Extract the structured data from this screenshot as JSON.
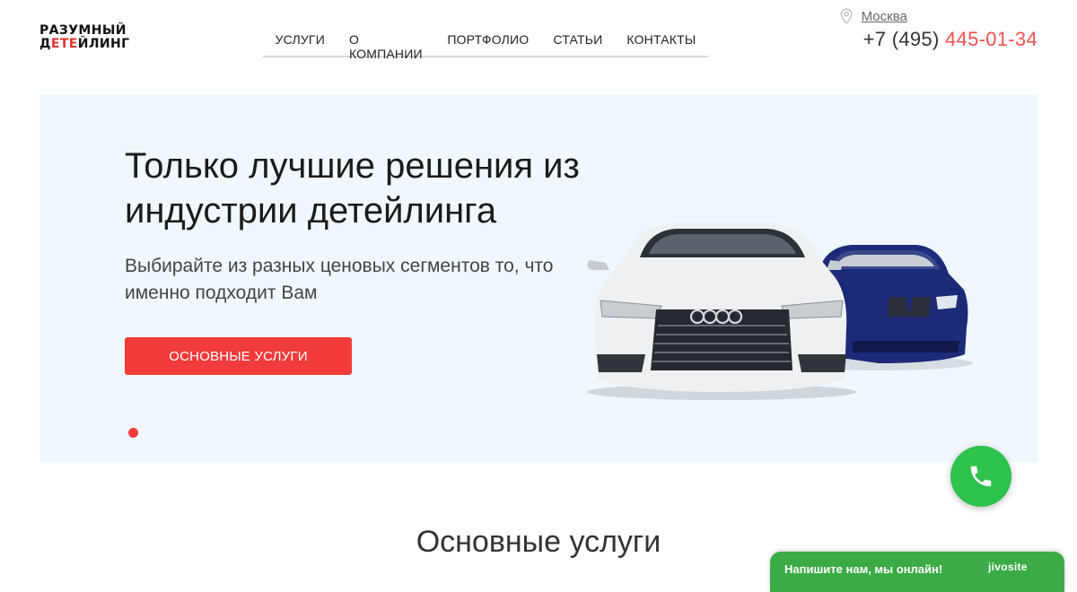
{
  "logo": {
    "line1": "РАЗУМНЫЙ",
    "line2_a": "Д",
    "line2_b": "ЕТЕ",
    "line2_c": "ЙЛИНГ"
  },
  "nav": {
    "items": [
      "УСЛУГИ",
      "О КОМПАНИИ",
      "ПОРТФОЛИО",
      "СТАТЬИ",
      "КОНТАКТЫ"
    ]
  },
  "contact": {
    "city": "Москва",
    "phone_prefix": "+7 (495) ",
    "phone_main": "445-01-34"
  },
  "hero": {
    "title": "Только лучшие решения из индустрии детейлинга",
    "subtitle": "Выбирайте из разных ценовых сегментов то, что именно подходит Вам",
    "cta": "ОСНОВНЫЕ УСЛУГИ"
  },
  "section": {
    "title": "Основные услуги"
  },
  "chat": {
    "message": "Напишите нам, мы онлайн!",
    "brand": "jivosite"
  },
  "colors": {
    "accent": "#f13c3b",
    "hero_bg": "#f1f8fd",
    "call_green": "#2fc24d",
    "chat_green": "#3bab45"
  },
  "icons": [
    "map-pin-icon",
    "phone-icon"
  ]
}
